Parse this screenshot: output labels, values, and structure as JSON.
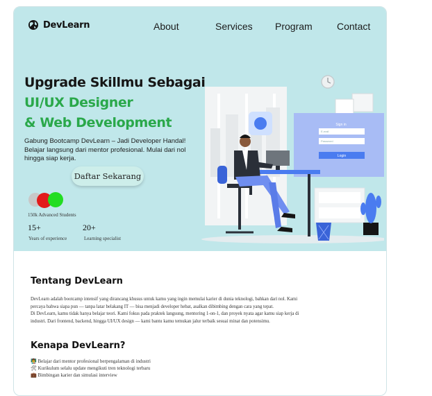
{
  "brand": {
    "name": "DevLearn"
  },
  "nav": {
    "items": [
      "About",
      "Services",
      "Program",
      "Contact"
    ]
  },
  "hero": {
    "title_line1": "Upgrade Skillmu Sebagai",
    "title_line2": "UI/UX Designer",
    "title_line3": "& Web Development",
    "lead_line1": "Gabung Bootcamp DevLearn – Jadi Developer Handal!",
    "lead_line2": "Belajar langsung dari mentor profesional. Mulai dari nol",
    "lead_line3": "hingga siap kerja.",
    "cta_label": "Daftar Sekarang",
    "students_caption": "150k Advanced Students",
    "stats": [
      {
        "value": "15+",
        "label": "Years of experience"
      },
      {
        "value": "20+",
        "label": "Learning specialist"
      }
    ],
    "illustration_signin": {
      "title": "Sign in",
      "email": "E-mail",
      "password": "Password",
      "button": "Login"
    }
  },
  "about": {
    "title": "Tentang DevLearn",
    "line1": "DevLearn adalah bootcamp intensif yang dirancang khusus untuk kamu yang ingin memulai karier di dunia teknologi, bahkan dari nol. Kami",
    "line2": "percaya bahwa siapa pun — tanpa latar belakang IT — bisa menjadi developer hebat, asalkan dibimbing dengan cara yang tepat.",
    "line3": "Di DevLearn, kamu tidak hanya belajar teori. Kami fokus pada praktek langsung, mentoring 1-on-1, dan proyek nyata agar kamu siap kerja di",
    "line4": "industri. Dari frontend, backend, hingga UI/UX design — kami bantu kamu temukan jalur terbaik sesuai minat dan potensimu."
  },
  "why": {
    "title": "Kenapa DevLearn?",
    "items": [
      {
        "icon": "👨‍🏫",
        "text": "Belajar dari mentor profesional berpengalaman di industri"
      },
      {
        "icon": "🛠",
        "text": "Kurikulum selalu update mengikuti tren teknologi terbaru"
      },
      {
        "icon": "💼",
        "text": "Bimbingan karier dan simulasi interview"
      }
    ]
  },
  "colors": {
    "hero_bg": "#c0e7ea",
    "accent_green": "#2aa84a",
    "illustration_blue": "#4a7cf0"
  }
}
